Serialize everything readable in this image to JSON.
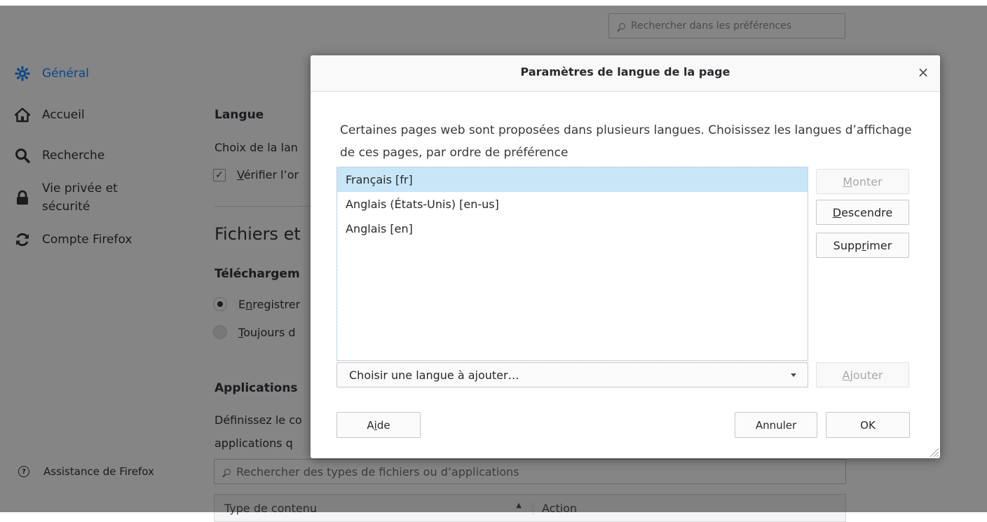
{
  "prefs_search": {
    "placeholder": "Rechercher dans les préférences"
  },
  "sidebar": {
    "items": [
      {
        "label": "Général",
        "icon": "gear-icon",
        "active": true
      },
      {
        "label": "Accueil",
        "icon": "home-icon"
      },
      {
        "label": "Recherche",
        "icon": "search-icon"
      },
      {
        "label_line1": "Vie privée et",
        "label_line2": "sécurité",
        "icon": "lock-icon"
      },
      {
        "label": "Compte Firefox",
        "icon": "sync-icon"
      }
    ],
    "support": {
      "label": "Assistance de Firefox",
      "icon": "help-icon"
    }
  },
  "pane": {
    "language_heading": "Langue",
    "language_choice": "Choix de la lan",
    "spellcheck_label": "Vérifier l’or",
    "spellcheck_access": "V",
    "spellcheck_rest": "érifier l’or",
    "spellcheck_checked": true,
    "files_heading": "Fichiers et",
    "downloads_heading": "Téléchargem",
    "save_option_pre": "E",
    "save_option_access": "n",
    "save_option_rest": "registrer",
    "always_ask_access": "T",
    "always_ask_rest": "oujours d",
    "applications_heading": "Applications",
    "applications_text_1": "Définissez le co",
    "applications_text_2": "applications q",
    "applications_search": "Rechercher des types de fichiers ou d’applications",
    "table_headers": [
      "Type de contenu",
      "Action"
    ]
  },
  "dialog": {
    "title": "Paramètres de langue de la page",
    "close_icon": "close-icon",
    "description": "Certaines pages web sont proposées dans plusieurs langues. Choisissez les langues d’affichage de ces pages, par ordre de préférence",
    "languages": [
      {
        "label": "Français [fr]",
        "selected": true
      },
      {
        "label": "Anglais (États-Unis) [en-us]",
        "selected": false
      },
      {
        "label": "Anglais [en]",
        "selected": false
      }
    ],
    "buttons": {
      "move_up": {
        "access": "M",
        "rest": "onter",
        "disabled": true
      },
      "move_down": {
        "access": "D",
        "rest": "escendre",
        "disabled": false
      },
      "remove": {
        "pre": "Supp",
        "access": "r",
        "rest": "imer",
        "disabled": false
      },
      "add": {
        "access": "A",
        "rest": "jouter",
        "disabled": true
      },
      "help": {
        "pre": "A",
        "access": "i",
        "rest": "de"
      },
      "cancel": "Annuler",
      "ok": "OK"
    },
    "add_language_select": "Choisir une langue à ajouter…"
  },
  "colors": {
    "accent": "#0a84ff",
    "selected_row": "#c8e6f7",
    "overlay": "rgba(12,12,13,0.5)"
  }
}
